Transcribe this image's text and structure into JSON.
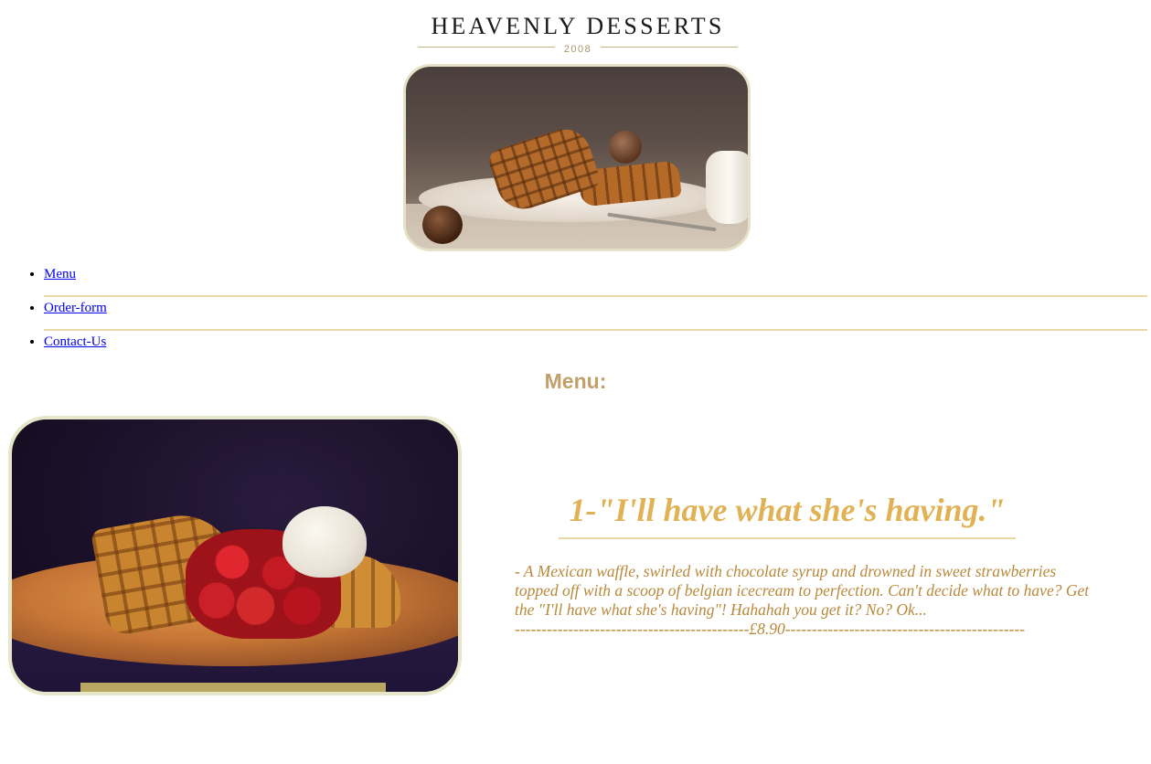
{
  "logo": {
    "title": "HEAVENLY DESSERTS",
    "year": "2008"
  },
  "nav": {
    "items": [
      {
        "label": "Menu"
      },
      {
        "label": "Order-form"
      },
      {
        "label": "Contact-Us"
      }
    ]
  },
  "main": {
    "heading": "Menu:",
    "item": {
      "title": "1-\"I'll have what she's having.\"",
      "description": "- A Mexican waffle, swirled with chocolate syrup and drowned in sweet strawberries topped off with a scoop of belgian icecream to perfection. Can't decide what to have? Get the \"I'll have what she's having\"! Hahahah you get it? No? Ok...",
      "price_line": "--------------------------------------------£8.90---------------------------------------------"
    }
  },
  "colors": {
    "accent_gold": "#e0b255",
    "heading_tan": "#c1a06a",
    "divider": "#e9d9a6",
    "link": "#0000ee"
  }
}
